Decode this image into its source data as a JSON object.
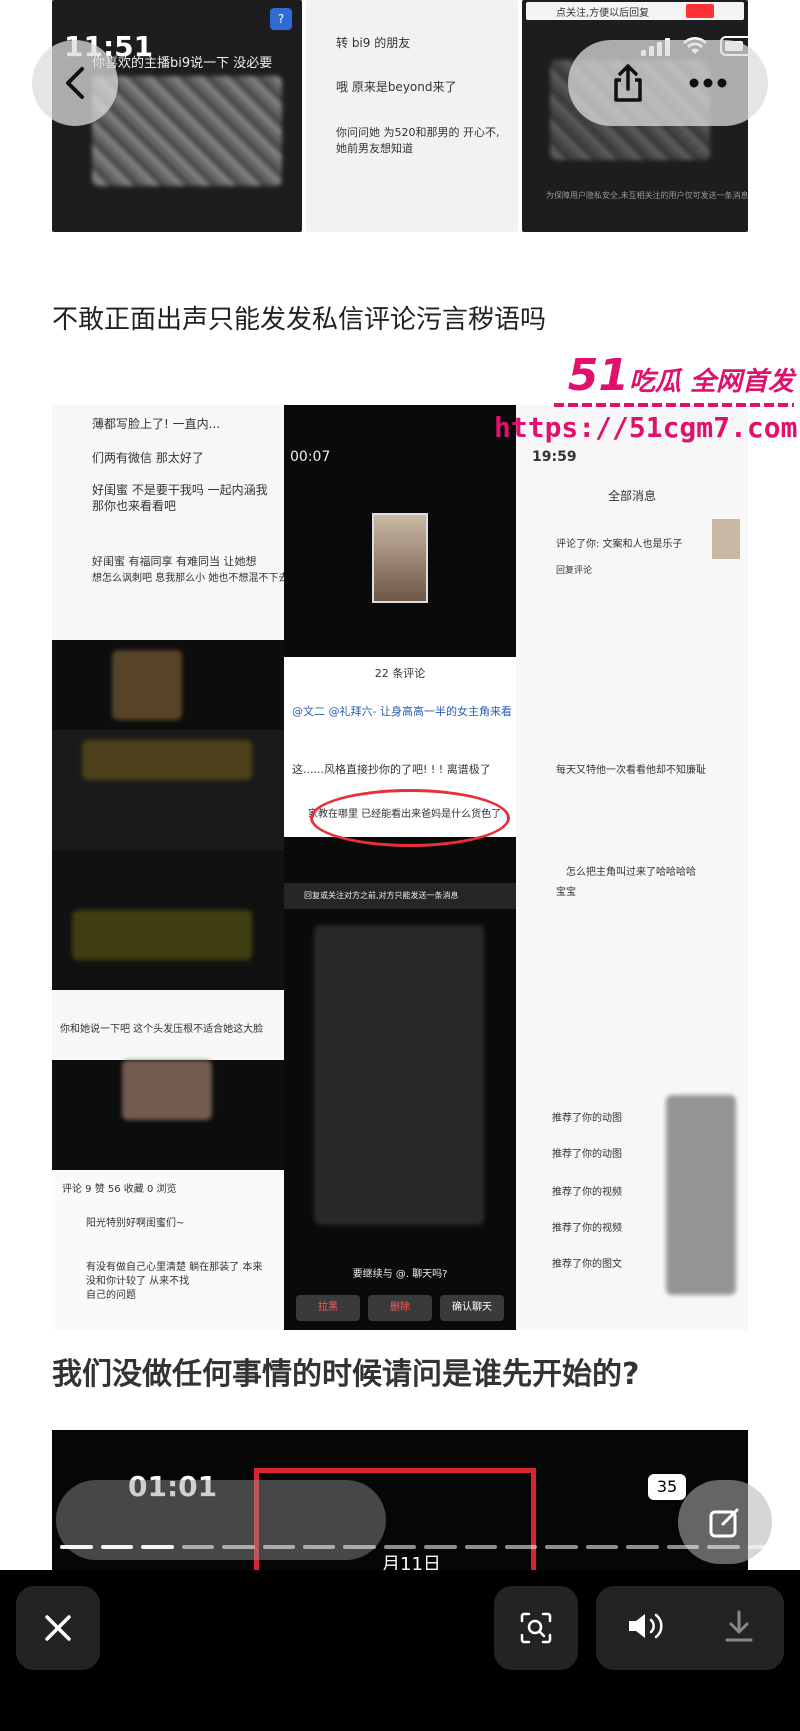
{
  "status": {
    "time": "11:51"
  },
  "article": {
    "para1": "不敢正面出声只能发发私信评论污言秽语吗",
    "para2": "我们没做任何事情的时候请问是谁先开始的?"
  },
  "watermark": {
    "brand_num": "51",
    "brand_text": "吃瓜 全网首发",
    "url": "https://51cgm7.com"
  },
  "screenshot_top": {
    "left_text": "你喜欢的主播bi9说一下 没必要",
    "mid_line1": "转 bi9 的朋友",
    "mid_line2": "哦 原来是beyond来了",
    "mid_line3": "你问问她 为520和那男的 开心不,",
    "mid_line4": "她前男友想知道",
    "right_banner": "点关注,方便以后回复",
    "right_note": "为保障用户隐私安全,未互相关注的用户仅可发送一条消息"
  },
  "collage": {
    "c1_line1": "薄都写脸上了! 一直内...",
    "c1_line2": "们两有微信 那太好了",
    "c1_line3": "好闺蜜 不是要干我吗 一起内涵我",
    "c1_line4": "那你也来看看吧",
    "c1_line5": "好闺蜜 有福同享 有难同当 让她想",
    "c1_line6": "想怎么讽刺吧 息我那么小 她也不想混不下去",
    "c1_line7": "你和她说一下吧 这个头发压根不适合她这大脸",
    "c2_time": "00:07",
    "c2_comments_title": "22 条评论",
    "c2_line1": "@文二 @礼拜六- 让身高高一半的女主角来看",
    "c2_line2": "这......风格直接抄你的了吧! ! ! 离谱极了",
    "c2_line3": "家教在哪里 已经能看出来爸妈是什么货色了",
    "c2_notice": "回复或关注对方之前,对方只能发送一条消息",
    "c2_continue": "要继续与 @. 聊天吗?",
    "c2_btn1": "拉黑",
    "c2_btn2": "删除",
    "c2_btn3": "确认聊天",
    "c3_time": "19:59",
    "c3_header": "全部消息",
    "c3_line1": "评论了你: 文案和人也是乐子",
    "c3_line2": "回复评论",
    "c3_line3": "每天又特他一次看看他却不知廉耻",
    "c3_line4": "怎么把主角叫过来了哈哈哈哈",
    "c3_line5": "宝宝",
    "c3_rec1": "推荐了你的动图",
    "c3_rec2": "推荐了你的动图",
    "c3_rec3": "推荐了你的视频",
    "c3_rec4": "推荐了你的视频",
    "c3_rec5": "推荐了你的图文",
    "c4_tabs": "评论 9   赞 56   收藏 0   浏览",
    "c4_line1": "阳光特别好啊闺蜜们~",
    "c4_line2": "有没有做自己心里清楚 躺在那装了 本来",
    "c4_line3": "没和你计较了 从来不找",
    "c4_line4": "自己的问题"
  },
  "bottom_shot": {
    "time": "01:01",
    "battery": "35",
    "date_fragment": "月11日"
  },
  "toolbar": {
    "close_icon": "close-icon",
    "lens_icon": "visual-lookup-icon",
    "sound_icon": "speaker-icon",
    "download_icon": "download-icon"
  },
  "colors": {
    "accent_red": "#e0106c",
    "toolbar_bg": "#000000",
    "button_bg": "#232325"
  }
}
